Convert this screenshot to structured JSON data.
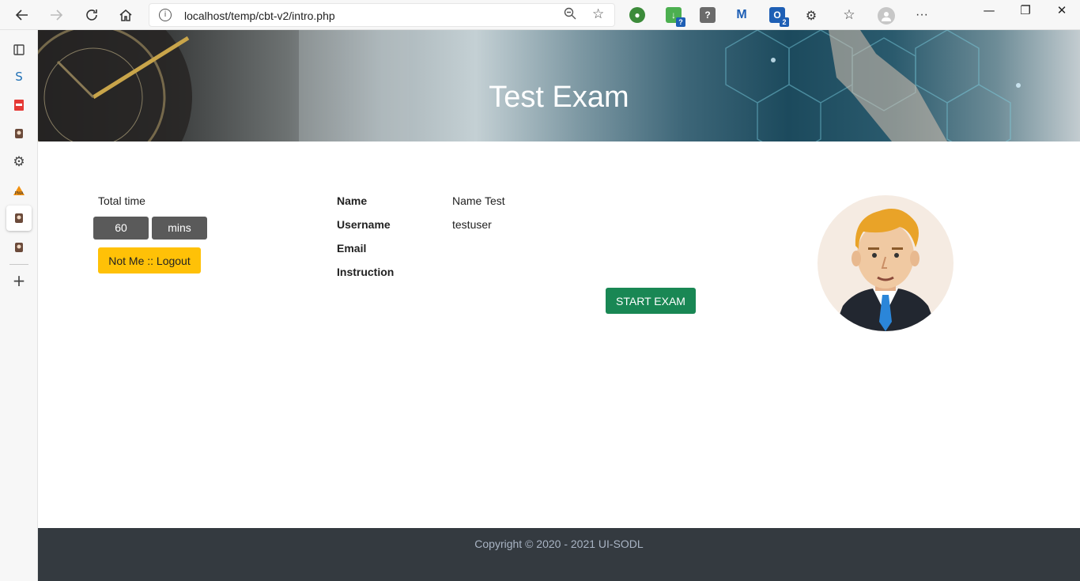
{
  "browser": {
    "url": "localhost/temp/cbt-v2/intro.php",
    "icons": {
      "back": "back-arrow-icon",
      "forward": "forward-arrow-icon",
      "refresh": "refresh-icon",
      "home": "home-icon",
      "site_info": "info-icon",
      "zoom": "zoom-out-icon",
      "add_favorite": "add-favorite-icon",
      "extensions": "extensions-icon",
      "favorites": "favorites-icon",
      "profile": "profile-icon",
      "more": "more-icon"
    },
    "extension_badges": {
      "download": "?",
      "office": "2"
    },
    "window": {
      "minimize": "—",
      "restore": "❐",
      "close": "✕"
    }
  },
  "sidebar": {
    "icons": [
      "tab-actions-icon",
      "sync-icon",
      "pdf-icon",
      "owl-extension-icon",
      "settings-icon",
      "pma-icon",
      "owl-extension-icon",
      "owl-extension-icon",
      "add-icon"
    ]
  },
  "page": {
    "title": "Test Exam",
    "total_time_label": "Total time",
    "total_time_value": "60",
    "total_time_unit": "mins",
    "logout_label": "Not Me :: Logout",
    "fields": {
      "name_label": "Name",
      "name_value": "Name Test",
      "username_label": "Username",
      "username_value": "testuser",
      "email_label": "Email",
      "email_value": "",
      "instruction_label": "Instruction"
    },
    "start_label": "START EXAM",
    "footer": "Copyright © 2020 - 2021 UI-SODL"
  },
  "colors": {
    "start_button": "#198754",
    "logout_button": "#ffc107",
    "time_box": "#5a5a5a",
    "footer_bg": "#343a40",
    "footer_text": "#a9b4c4"
  }
}
